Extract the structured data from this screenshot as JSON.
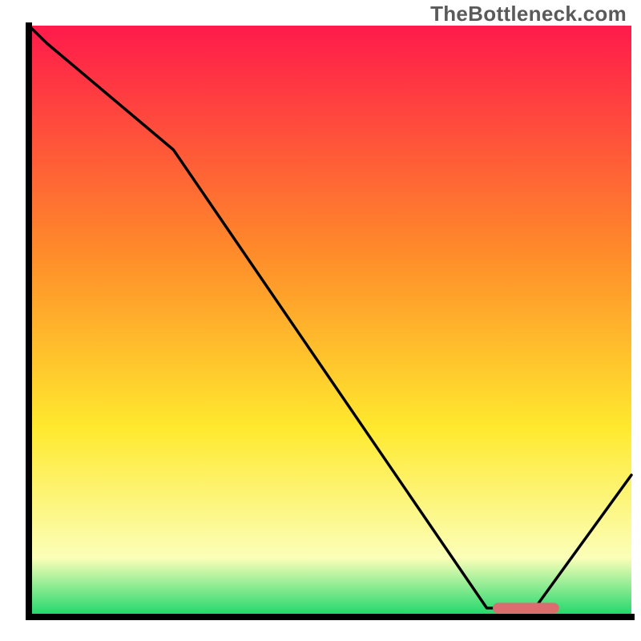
{
  "watermark": "TheBottleneck.com",
  "colors": {
    "axis": "#000000",
    "curve": "#000000",
    "marker_fill": "#d96d6f",
    "marker_stroke": "#d96d6f",
    "grad_top": "#ff1a4b",
    "grad_orange": "#ff8a2a",
    "grad_yellow": "#ffe92e",
    "grad_pale": "#fbffb8",
    "grad_green": "#18d66a"
  },
  "chart_data": {
    "type": "line",
    "title": "",
    "xlabel": "",
    "ylabel": "",
    "xlim": [
      0,
      100
    ],
    "ylim": [
      0,
      100
    ],
    "legend": false,
    "grid": false,
    "background": "vertical rainbow gradient (red→orange→yellow→pale→green)",
    "x": [
      0,
      3,
      24,
      76,
      84,
      100
    ],
    "values": [
      100,
      97,
      79,
      1.5,
      1.5,
      24
    ],
    "annotations": [
      {
        "type": "bar-marker",
        "x_range": [
          77,
          88
        ],
        "y": 1.5,
        "note": "rounded pink segment at curve minimum"
      }
    ]
  }
}
